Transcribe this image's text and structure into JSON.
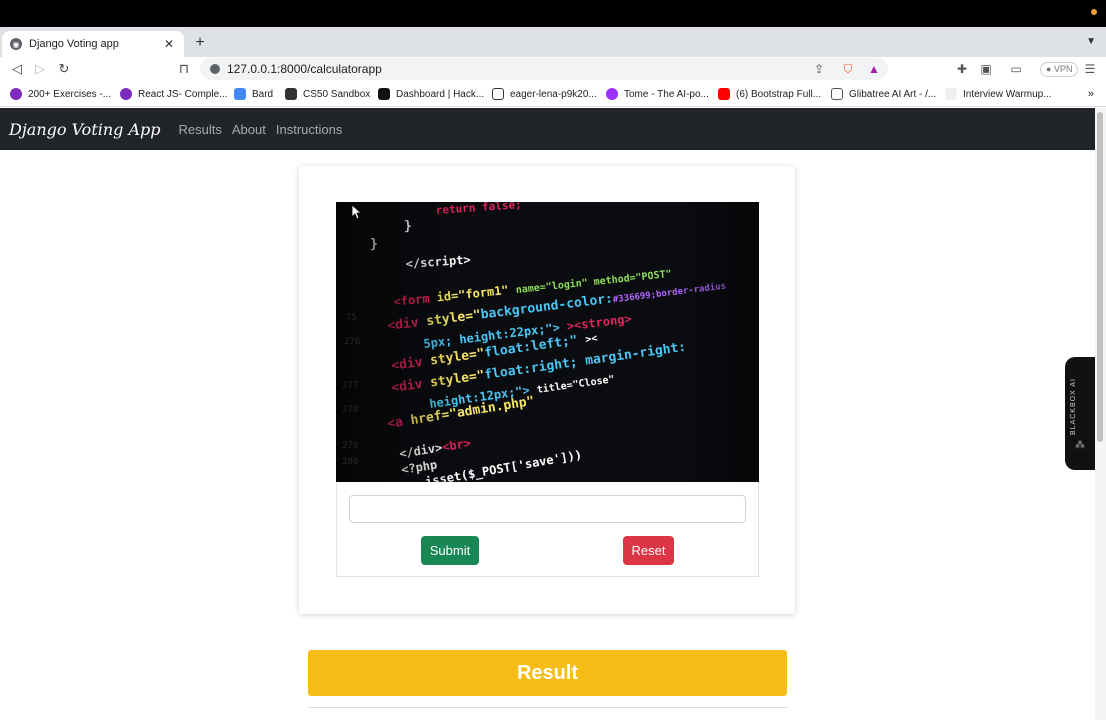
{
  "browser": {
    "tab_title": "Django Voting app",
    "url": "127.0.0.1:8000/calculatorapp",
    "vpn_label": "VPN",
    "bookmarks": [
      {
        "label": "200+ Exercises -...",
        "icon_color": "#7b2cbf"
      },
      {
        "label": "React JS- Comple...",
        "icon_color": "#7b2cbf"
      },
      {
        "label": "Bard",
        "icon_color": "#4285f4"
      },
      {
        "label": "CS50 Sandbox",
        "icon_color": "#333333"
      },
      {
        "label": "Dashboard | Hack...",
        "icon_color": "#111111"
      },
      {
        "label": "eager-lena-p9k20...",
        "icon_color": "#ffffff"
      },
      {
        "label": "Tome - The AI-po...",
        "icon_color": "#9b30ff"
      },
      {
        "label": "(6) Bootstrap Full...",
        "icon_color": "#ff0000"
      },
      {
        "label": "Glibatree AI Art - /...",
        "icon_color": "#888888"
      },
      {
        "label": "Interview Warmup...",
        "icon_color": "#dddddd"
      }
    ]
  },
  "navbar": {
    "brand": "Django Voting App",
    "links": [
      "Results",
      "About",
      "Instructions"
    ]
  },
  "form": {
    "input_value": "",
    "submit_label": "Submit",
    "reset_label": "Reset"
  },
  "result": {
    "label": "Result"
  },
  "blackbox": {
    "label": "BLACKBOX AI"
  },
  "colors": {
    "navbar_bg": "#212529",
    "submit_bg": "#198754",
    "reset_bg": "#dc3545",
    "result_bg": "#f5bd15"
  }
}
